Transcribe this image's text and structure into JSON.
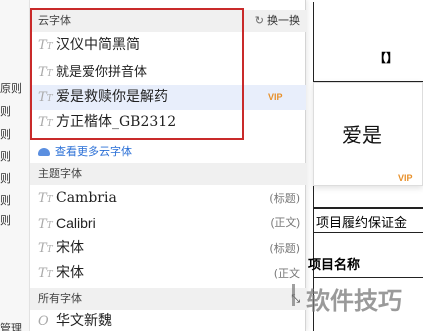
{
  "left_labels": [
    "原则",
    "则",
    "则",
    "则",
    "则",
    "则",
    "则",
    "管理"
  ],
  "menu": {
    "cloud_header": "云字体",
    "swap_label": "换一换",
    "cloud_fonts": [
      {
        "name": "汉仪中简黑简",
        "vip": ""
      },
      {
        "name": "就是爱你拼音体",
        "vip": ""
      },
      {
        "name": "爱是救赎你是解药",
        "vip": "VIP"
      },
      {
        "name": "方正楷体_GB2312",
        "vip": ""
      }
    ],
    "more_link": "查看更多云字体",
    "theme_header": "主题字体",
    "theme_fonts": [
      {
        "name": "Cambria",
        "tag": "(标题)"
      },
      {
        "name": "Calibri",
        "tag": "(正文)"
      },
      {
        "name": "宋体",
        "tag": "(标题)"
      },
      {
        "name": "宋体",
        "tag": "(正文"
      }
    ],
    "all_header": "所有字体",
    "all_fonts": [
      {
        "name": "华文新魏"
      }
    ]
  },
  "preview": {
    "text": "爱是",
    "vip": "VIP"
  },
  "document": {
    "cell1": "项目履约保证金",
    "cell2": "项目名称",
    "marker": "【】"
  },
  "watermark": "软件技巧"
}
